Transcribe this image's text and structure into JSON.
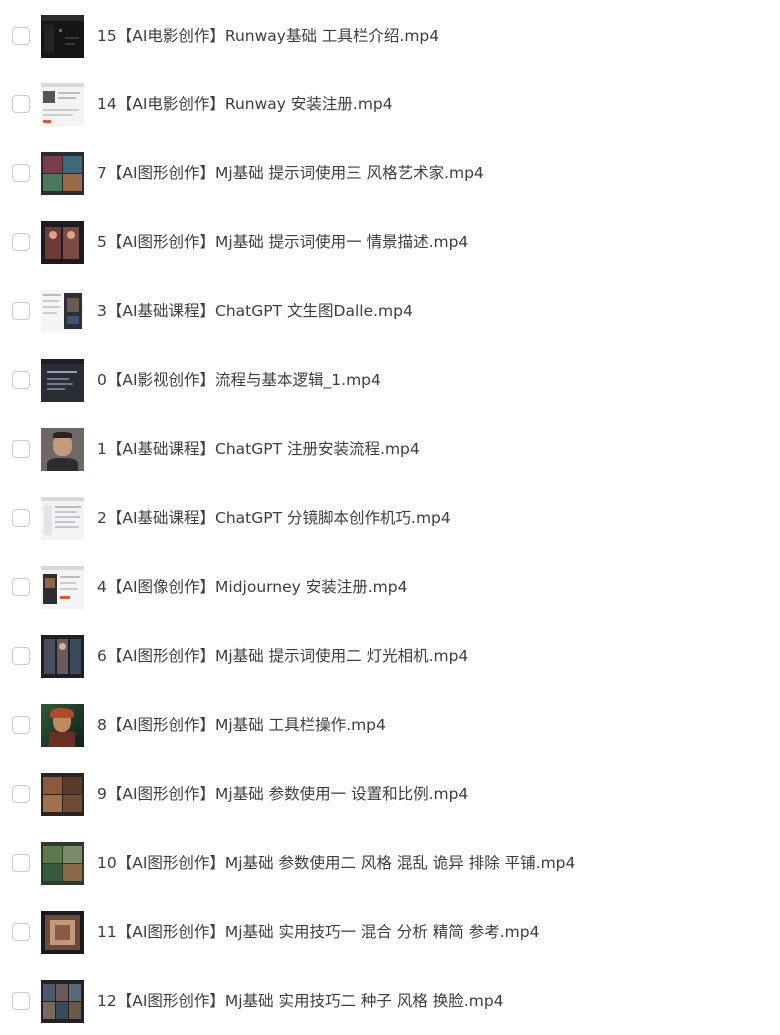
{
  "files": [
    {
      "name": "15【AI电影创作】Runway基础 工具栏介绍.mp4",
      "thumb": "dark-editor"
    },
    {
      "name": "14【AI电影创作】Runway 安装注册.mp4",
      "thumb": "web-page"
    },
    {
      "name": "7【AI图形创作】Mj基础 提示词使用三 风格艺术家.mp4",
      "thumb": "art-grid"
    },
    {
      "name": "5【AI图形创作】Mj基础 提示词使用一 情景描述.mp4",
      "thumb": "portrait-dark"
    },
    {
      "name": "3【AI基础课程】ChatGPT 文生图Dalle.mp4",
      "thumb": "doc-with-image"
    },
    {
      "name": "0【AI影视创作】流程与基本逻辑_1.mp4",
      "thumb": "slide-dark"
    },
    {
      "name": "1【AI基础课程】ChatGPT 注册安装流程.mp4",
      "thumb": "face-cam"
    },
    {
      "name": "2【AI基础课程】ChatGPT 分镜脚本创作机巧.mp4",
      "thumb": "doc-page"
    },
    {
      "name": "4【AI图像创作】Midjourney 安装注册.mp4",
      "thumb": "web-page"
    },
    {
      "name": "6【AI图形创作】Mj基础 提示词使用二 灯光相机.mp4",
      "thumb": "art-grid-dark"
    },
    {
      "name": "8【AI图形创作】Mj基础 工具栏操作.mp4",
      "thumb": "portrait-green"
    },
    {
      "name": "9【AI图形创作】Mj基础 参数使用一 设置和比例.mp4",
      "thumb": "art-warm"
    },
    {
      "name": "10【AI图形创作】Mj基础 参数使用二 风格 混乱 诡异 排除 平铺.mp4",
      "thumb": "art-nature"
    },
    {
      "name": "11【AI图形创作】Mj基础 实用技巧一 混合 分析 精简 参考.mp4",
      "thumb": "art-frame"
    },
    {
      "name": "12【AI图形创作】Mj基础 实用技巧二 种子 风格 换脸.mp4",
      "thumb": "art-grid-blue"
    }
  ],
  "colors": {
    "text": "#3a3d42",
    "checkbox_border": "#c9ccd1",
    "background": "#ffffff"
  }
}
